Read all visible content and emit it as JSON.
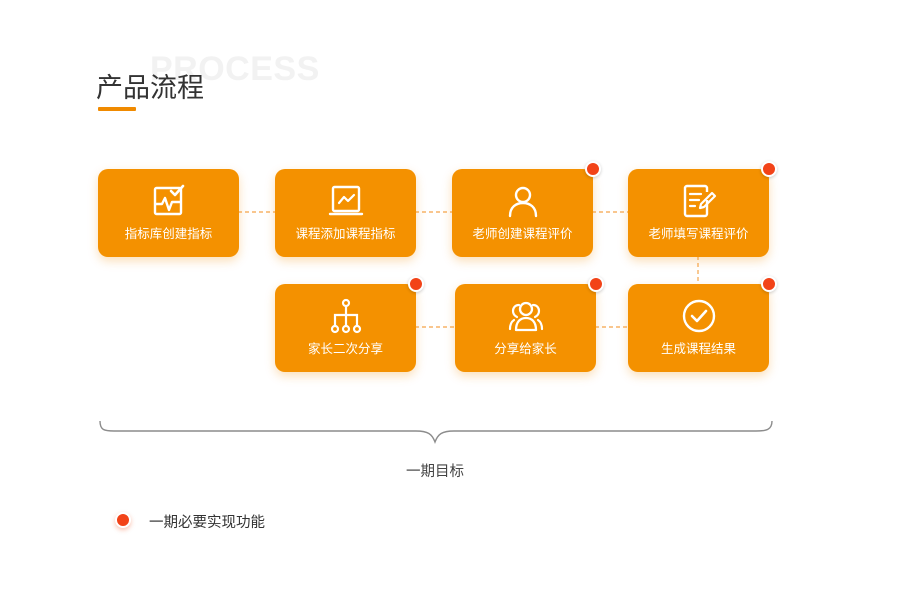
{
  "header": {
    "watermark": "PROCESS",
    "title": "产品流程"
  },
  "steps": [
    {
      "label": "指标库创建指标",
      "icon": "chart-check-icon",
      "required": false
    },
    {
      "label": "课程添加课程指标",
      "icon": "presentation-chart-icon",
      "required": false
    },
    {
      "label": "老师创建课程评价",
      "icon": "user-icon",
      "required": true
    },
    {
      "label": "老师填写课程评价",
      "icon": "document-edit-icon",
      "required": true
    },
    {
      "label": "家长二次分享",
      "icon": "tree-share-icon",
      "required": true
    },
    {
      "label": "分享给家长",
      "icon": "group-icon",
      "required": true
    },
    {
      "label": "生成课程结果",
      "icon": "check-circle-icon",
      "required": true
    }
  ],
  "phase": {
    "label": "一期目标"
  },
  "legend": {
    "text": "一期必要实现功能"
  },
  "colors": {
    "card": "#f49100",
    "accent": "#f08a00",
    "required_dot": "#f24318"
  }
}
